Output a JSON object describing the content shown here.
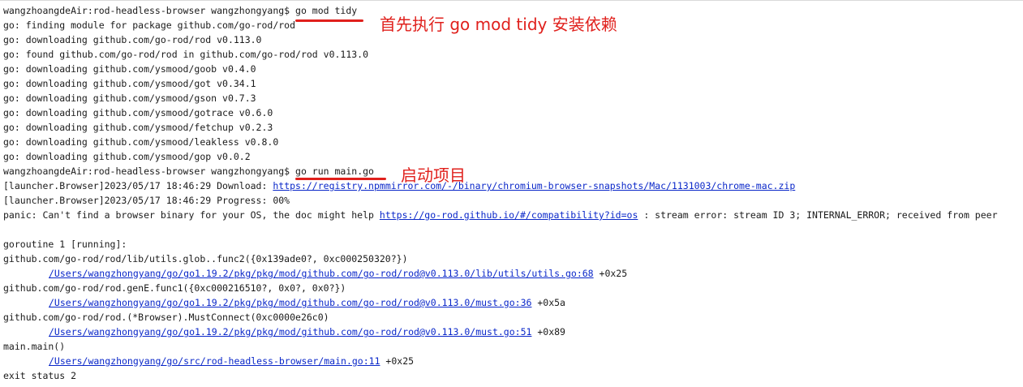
{
  "terminal": {
    "prompt": "wangzhoangdeAir:rod-headless-browser wangzhongyang$ ",
    "cmd1": "go mod tidy",
    "tidy_output": [
      "go: finding module for package github.com/go-rod/rod",
      "go: downloading github.com/go-rod/rod v0.113.0",
      "go: found github.com/go-rod/rod in github.com/go-rod/rod v0.113.0",
      "go: downloading github.com/ysmood/goob v0.4.0",
      "go: downloading github.com/ysmood/got v0.34.1",
      "go: downloading github.com/ysmood/gson v0.7.3",
      "go: downloading github.com/ysmood/gotrace v0.6.0",
      "go: downloading github.com/ysmood/fetchup v0.2.3",
      "go: downloading github.com/ysmood/leakless v0.8.0",
      "go: downloading github.com/ysmood/gop v0.0.2"
    ],
    "cmd2": "go run main.go",
    "download_prefix": "[launcher.Browser]2023/05/17 18:46:29 Download: ",
    "download_url": "https://registry.npmmirror.com/-/binary/chromium-browser-snapshots/Mac/1131003/chrome-mac.zip",
    "progress_line": "[launcher.Browser]2023/05/17 18:46:29 Progress: 00%",
    "panic_prefix": "panic: Can't find a browser binary for your OS, the doc might help ",
    "panic_url": "https://go-rod.github.io/#/compatibility?id=os",
    "panic_suffix": " : stream error: stream ID 3; INTERNAL_ERROR; received from peer",
    "goroutine": "goroutine 1 [running]:",
    "frame1_func": "github.com/go-rod/rod/lib/utils.glob..func2({0x139ade0?, 0xc000250320?})",
    "frame1_path": "/Users/wangzhongyang/go/go1.19.2/pkg/pkg/mod/github.com/go-rod/rod@v0.113.0/lib/utils/utils.go:68",
    "frame1_off": " +0x25",
    "frame2_func": "github.com/go-rod/rod.genE.func1({0xc000216510?, 0x0?, 0x0?})",
    "frame2_path": "/Users/wangzhongyang/go/go1.19.2/pkg/pkg/mod/github.com/go-rod/rod@v0.113.0/must.go:36",
    "frame2_off": " +0x5a",
    "frame3_func": "github.com/go-rod/rod.(*Browser).MustConnect(0xc0000e26c0)",
    "frame3_path": "/Users/wangzhongyang/go/go1.19.2/pkg/pkg/mod/github.com/go-rod/rod@v0.113.0/must.go:51",
    "frame3_off": " +0x89",
    "frame4_func": "main.main()",
    "frame4_path": "/Users/wangzhongyang/go/src/rod-headless-browser/main.go:11",
    "frame4_off": " +0x25",
    "exit": "exit status 2"
  },
  "annotations": {
    "note1": "首先执行 go mod tidy 安装依赖",
    "note2": "启动项目",
    "color": "#e0201c"
  }
}
